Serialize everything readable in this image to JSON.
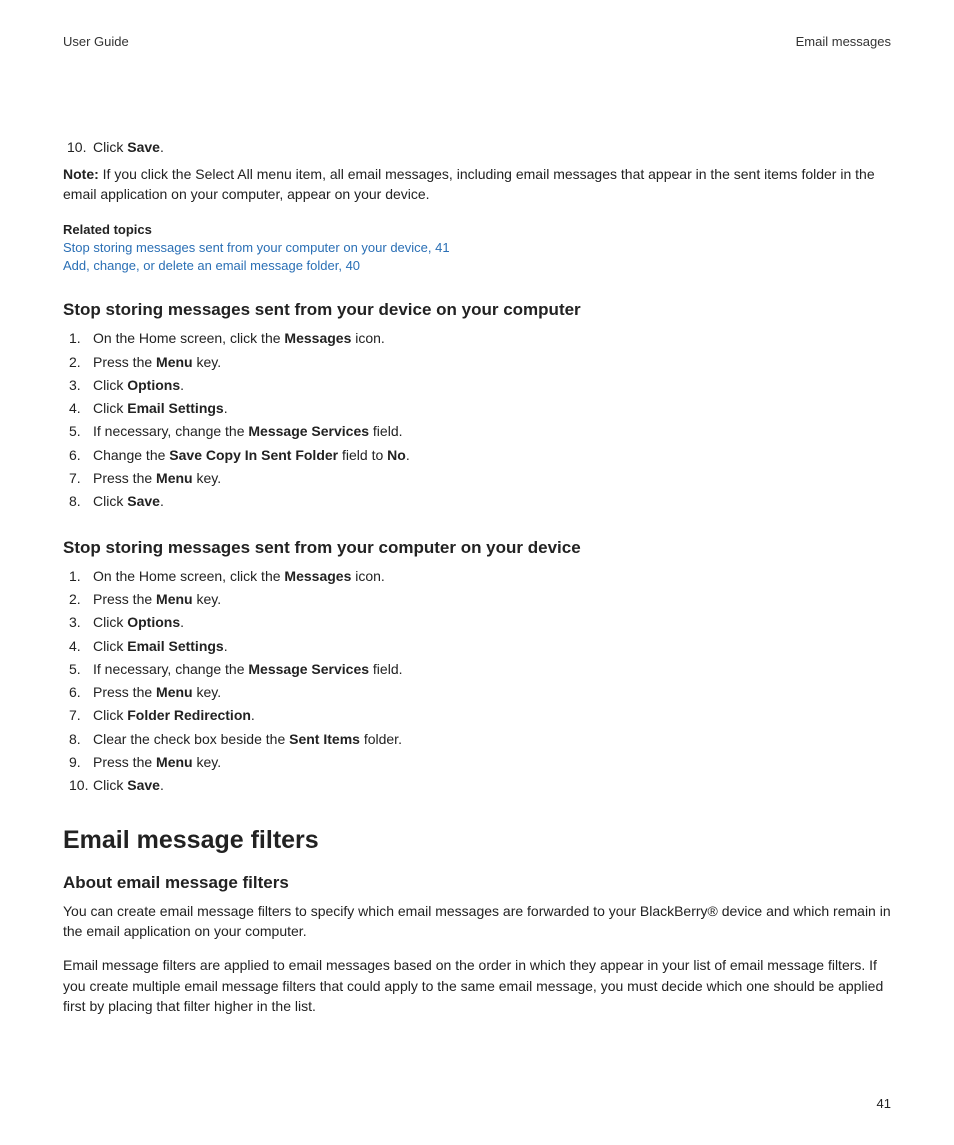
{
  "header": {
    "left": "User Guide",
    "right": "Email messages"
  },
  "topList": {
    "num": "10.",
    "pre": "Click ",
    "bold": "Save",
    "post": "."
  },
  "note": {
    "label": "Note:",
    "body": " If you click the Select All menu item, all email messages, including email messages that appear in the sent items folder in the email application on your computer, appear on your device."
  },
  "related": {
    "heading": "Related topics",
    "links": [
      "Stop storing messages sent from your computer on your device, 41",
      "Add, change, or delete an email message folder, 40"
    ]
  },
  "sectionA": {
    "heading": "Stop storing messages sent from your device on your computer",
    "steps": [
      {
        "num": "1.",
        "parts": [
          "On the Home screen, click the ",
          "Messages",
          " icon."
        ]
      },
      {
        "num": "2.",
        "parts": [
          "Press the ",
          "Menu",
          " key."
        ]
      },
      {
        "num": "3.",
        "parts": [
          "Click ",
          "Options",
          "."
        ]
      },
      {
        "num": "4.",
        "parts": [
          "Click ",
          "Email Settings",
          "."
        ]
      },
      {
        "num": "5.",
        "parts": [
          "If necessary, change the ",
          "Message Services",
          " field."
        ]
      },
      {
        "num": "6.",
        "parts": [
          "Change the ",
          "Save Copy In Sent Folder",
          " field to ",
          "No",
          "."
        ]
      },
      {
        "num": "7.",
        "parts": [
          "Press the ",
          "Menu",
          " key."
        ]
      },
      {
        "num": "8.",
        "parts": [
          "Click ",
          "Save",
          "."
        ]
      }
    ]
  },
  "sectionB": {
    "heading": "Stop storing messages sent from your computer on your device",
    "steps": [
      {
        "num": "1.",
        "parts": [
          "On the Home screen, click the ",
          "Messages",
          " icon."
        ]
      },
      {
        "num": "2.",
        "parts": [
          "Press the ",
          "Menu",
          " key."
        ]
      },
      {
        "num": "3.",
        "parts": [
          "Click ",
          "Options",
          "."
        ]
      },
      {
        "num": "4.",
        "parts": [
          "Click ",
          "Email Settings",
          "."
        ]
      },
      {
        "num": "5.",
        "parts": [
          "If necessary, change the ",
          "Message Services",
          " field."
        ]
      },
      {
        "num": "6.",
        "parts": [
          "Press the ",
          "Menu",
          " key."
        ]
      },
      {
        "num": "7.",
        "parts": [
          "Click ",
          "Folder Redirection",
          "."
        ]
      },
      {
        "num": "8.",
        "parts": [
          "Clear the check box beside the ",
          "Sent Items",
          " folder."
        ]
      },
      {
        "num": "9.",
        "parts": [
          "Press the ",
          "Menu",
          " key."
        ]
      },
      {
        "num": "10.",
        "parts": [
          "Click ",
          "Save",
          "."
        ]
      }
    ]
  },
  "filters": {
    "heading": "Email message filters",
    "subheading": "About email message filters",
    "para1": "You can create email message filters to specify which email messages are forwarded to your BlackBerry® device and which remain in the email application on your computer.",
    "para2": "Email message filters are applied to email messages based on the order in which they appear in your list of email message filters. If you create multiple email message filters that could apply to the same email message, you must decide which one should be applied first by placing that filter higher in the list."
  },
  "pageNumber": "41"
}
